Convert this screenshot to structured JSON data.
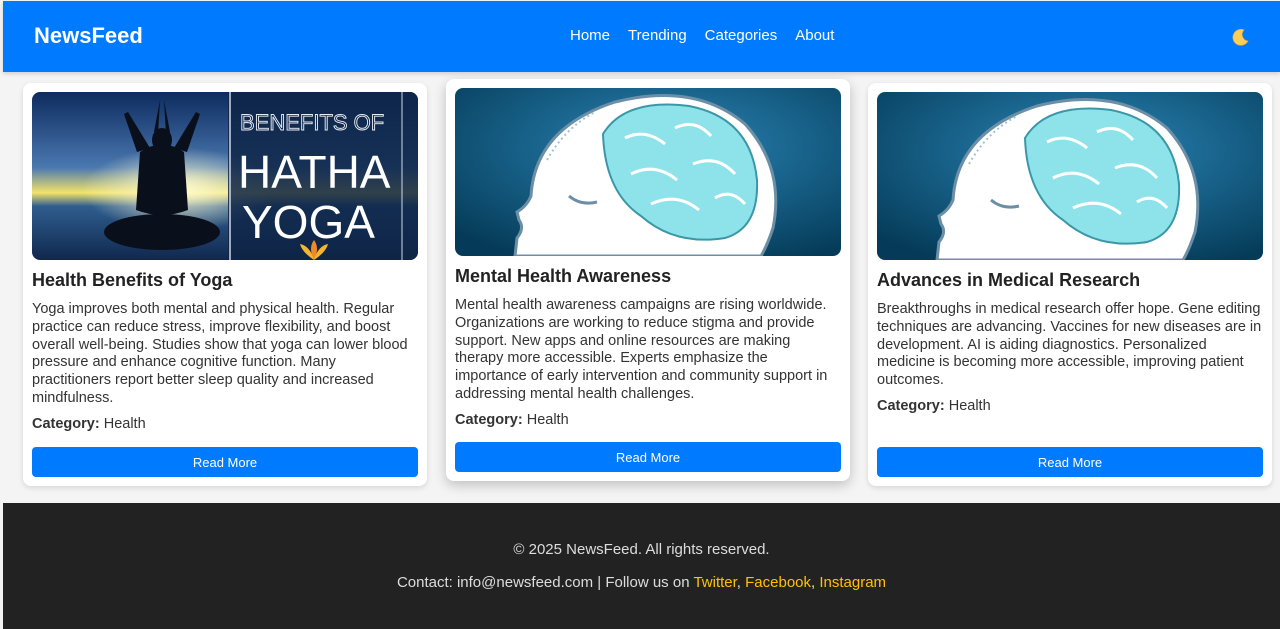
{
  "header": {
    "logo": "NewsFeed",
    "nav": [
      "Home",
      "Trending",
      "Categories",
      "About"
    ],
    "theme_icon": "moon-icon"
  },
  "articles": [
    {
      "image_text": {
        "line1": "BENEFITS OF",
        "line2": "HATHA",
        "line3": "YOGA"
      },
      "title": "Health Benefits of Yoga",
      "summary": "Yoga improves both mental and physical health. Regular practice can reduce stress, improve flexibility, and boost overall well-being. Studies show that yoga can lower blood pressure and enhance cognitive function. Many practitioners report better sleep quality and increased mindfulness.",
      "category_label": "Category:",
      "category": "Health",
      "button": "Read More"
    },
    {
      "title": "Mental Health Awareness",
      "summary": "Mental health awareness campaigns are rising worldwide. Organizations are working to reduce stigma and provide support. New apps and online resources are making therapy more accessible. Experts emphasize the importance of early intervention and community support in addressing mental health challenges.",
      "category_label": "Category:",
      "category": "Health",
      "button": "Read More"
    },
    {
      "title": "Advances in Medical Research",
      "summary": "Breakthroughs in medical research offer hope. Gene editing techniques are advancing. Vaccines for new diseases are in development. AI is aiding diagnostics. Personalized medicine is becoming more accessible, improving patient outcomes.",
      "category_label": "Category:",
      "category": "Health",
      "button": "Read More"
    }
  ],
  "footer": {
    "copyright": "© 2025 NewsFeed. All rights reserved.",
    "contact_prefix": "Contact: info@newsfeed.com | Follow us on",
    "links": [
      "Twitter",
      "Facebook",
      "Instagram"
    ]
  },
  "colors": {
    "primary": "#007bff",
    "footer_bg": "#222222",
    "link": "#ffc107"
  }
}
